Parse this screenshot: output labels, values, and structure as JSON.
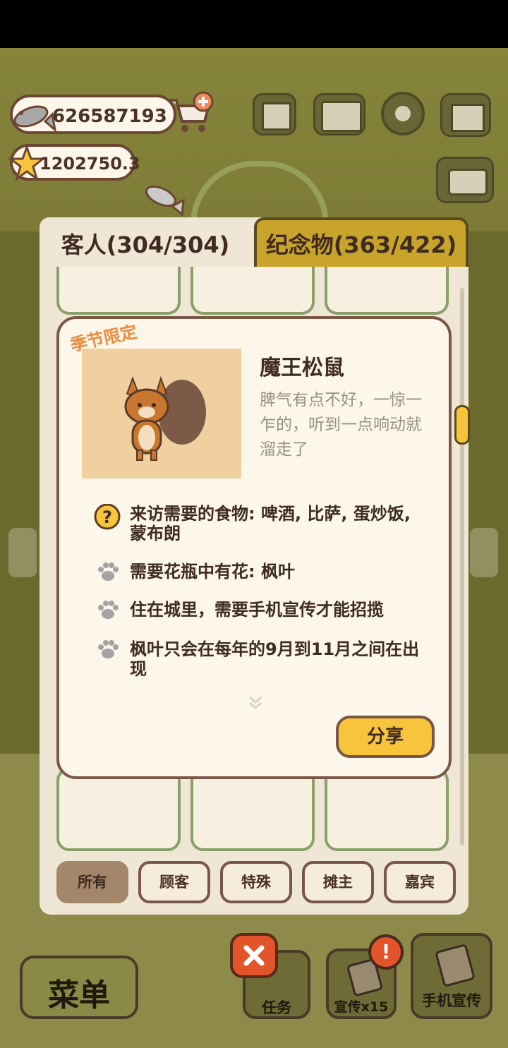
{
  "hud": {
    "fish_count": "626587193",
    "star_count": "1202750.3"
  },
  "tabs": {
    "guests": "客人(304/304)",
    "souvenirs": "纪念物(363/422)"
  },
  "dialog": {
    "badge": "季节限定",
    "name": "魔王松鼠",
    "description": "脾气有点不好，一惊一乍的，听到一点响动就溜走了",
    "requirements": [
      {
        "icon": "question-icon",
        "text": "来访需要的食物: 啤酒, 比萨, 蛋炒饭, 蒙布朗"
      },
      {
        "icon": "paw-icon",
        "text": "需要花瓶中有花: 枫叶"
      },
      {
        "icon": "paw-icon",
        "text": "住在城里，需要手机宣传才能招揽"
      },
      {
        "icon": "paw-icon",
        "text": "枫叶只会在每年的9月到11月之间在出现"
      }
    ],
    "share_label": "分享"
  },
  "filters": [
    "所有",
    "顾客",
    "特殊",
    "摊主",
    "嘉宾"
  ],
  "bottom": {
    "menu": "菜单",
    "task": "任务",
    "promo": "宣传x15",
    "phone_promo": "手机宣传"
  },
  "colors": {
    "panel_bg": "#efe6d6",
    "dialog_bg": "#fdf6ea",
    "accent_yellow": "#f7c53b",
    "border_brown": "#7a5646",
    "close_red": "#e2552b"
  }
}
